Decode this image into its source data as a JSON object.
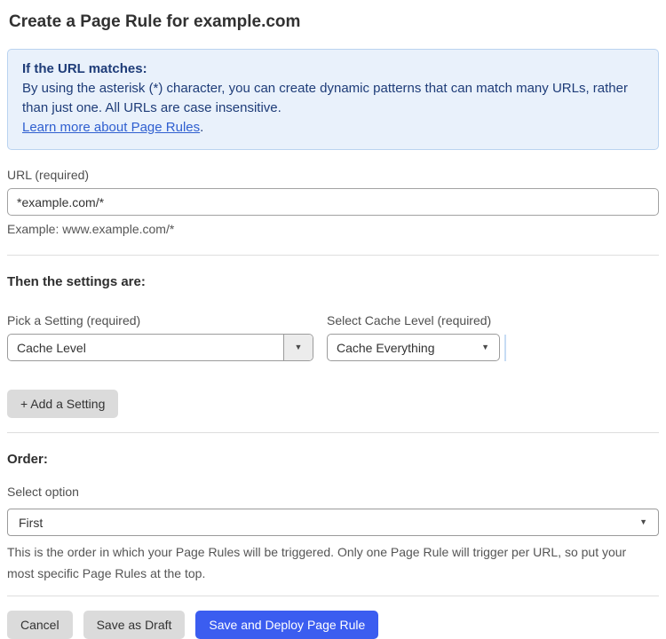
{
  "page": {
    "title": "Create a Page Rule for example.com"
  },
  "info_box": {
    "heading": "If the URL matches:",
    "body": "By using the asterisk (*) character, you can create dynamic patterns that can match many URLs, rather than just one. All URLs are case insensitive.",
    "link_label": "Learn more about Page Rules",
    "link_suffix": "."
  },
  "url_field": {
    "label": "URL (required)",
    "value": "*example.com/*",
    "example": "Example: www.example.com/*"
  },
  "settings_section": {
    "heading": "Then the settings are:",
    "setting_picker": {
      "label": "Pick a Setting (required)",
      "value": "Cache Level"
    },
    "cache_level_picker": {
      "label": "Select Cache Level (required)",
      "value": "Cache Everything"
    },
    "add_setting_label": "+ Add a Setting"
  },
  "order_section": {
    "heading": "Order:",
    "label": "Select option",
    "value": "First",
    "help": "This is the order in which your Page Rules will be triggered. Only one Page Rule will trigger per URL, so put your most specific Page Rules at the top."
  },
  "actions": {
    "cancel_label": "Cancel",
    "save_draft_label": "Save as Draft",
    "save_deploy_label": "Save and Deploy Page Rule"
  },
  "icons": {
    "caret_down": "▼"
  },
  "colors": {
    "accent_blue": "#3b5df0",
    "info_bg": "#e9f1fb",
    "info_border": "#bad3f0",
    "info_text": "#1e3c78",
    "link_blue": "#2f5fd0",
    "button_gray": "#dbdbdb"
  }
}
